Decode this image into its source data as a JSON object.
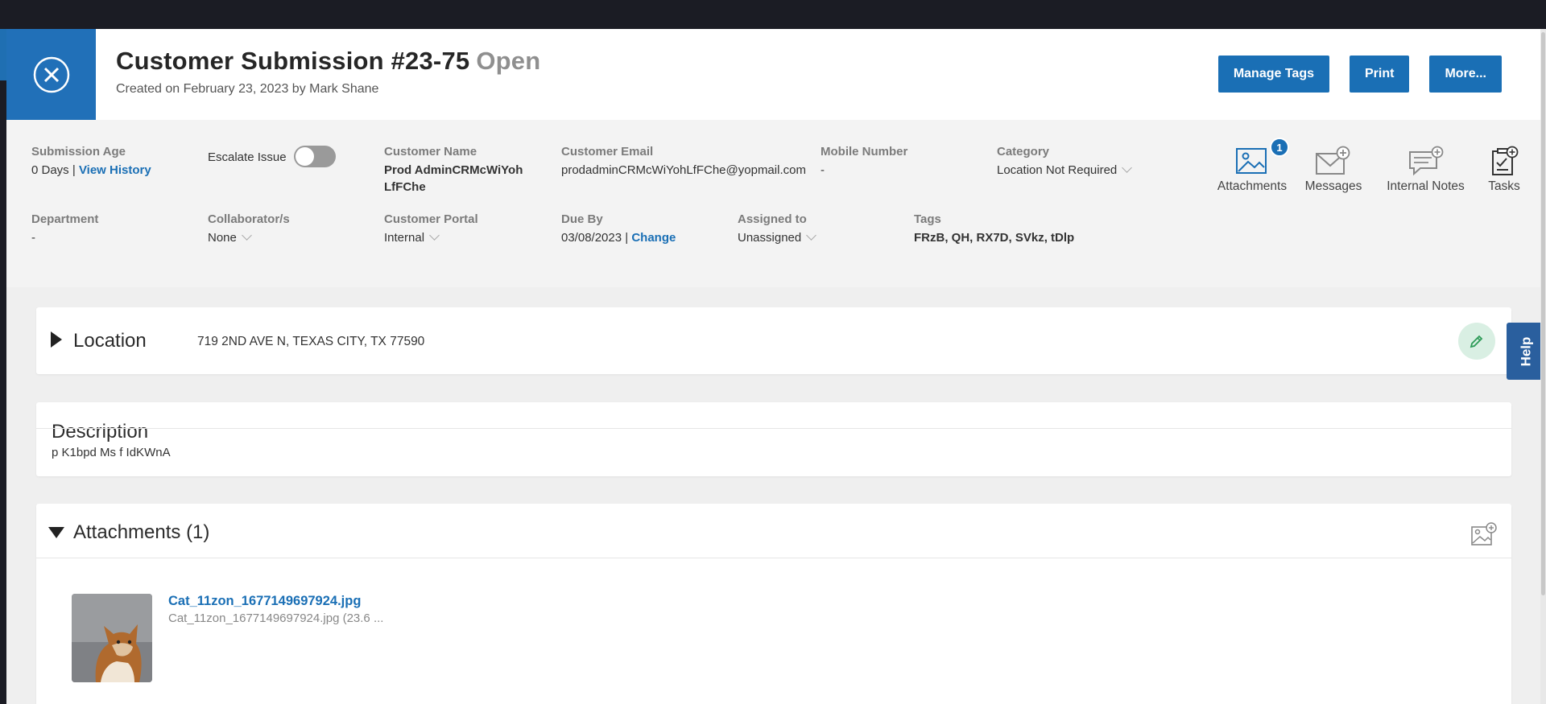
{
  "header": {
    "title": "Customer Submission #23-75",
    "status": "Open",
    "subtitle": "Created on February 23, 2023 by Mark Shane",
    "buttons": {
      "manage_tags": "Manage Tags",
      "print": "Print",
      "more": "More..."
    }
  },
  "info": {
    "submission_age": {
      "label": "Submission Age",
      "value": "0 Days",
      "separator": "|",
      "link": "View History"
    },
    "escalate": {
      "label": "Escalate Issue"
    },
    "customer_name": {
      "label": "Customer Name",
      "line1": "Prod AdminCRMcWiYoh",
      "line2": "LfFChe"
    },
    "customer_email": {
      "label": "Customer Email",
      "value": "prodadminCRMcWiYohLfFChe@yopmail.com"
    },
    "mobile": {
      "label": "Mobile Number",
      "value": "-"
    },
    "category": {
      "label": "Category",
      "value": "Location Not Required"
    },
    "department": {
      "label": "Department",
      "value": "-"
    },
    "collaborators": {
      "label": "Collaborator/s",
      "value": "None"
    },
    "portal": {
      "label": "Customer Portal",
      "value": "Internal"
    },
    "due_by": {
      "label": "Due By",
      "value": "03/08/2023",
      "separator": "|",
      "link": "Change"
    },
    "assigned": {
      "label": "Assigned to",
      "value": "Unassigned"
    },
    "tags": {
      "label": "Tags",
      "value": "FRzB, QH, RX7D, SVkz, tDlp"
    }
  },
  "tools": {
    "attachments": {
      "label": "Attachments",
      "count": "1"
    },
    "messages": {
      "label": "Messages"
    },
    "internal_notes": {
      "label": "Internal Notes"
    },
    "tasks": {
      "label": "Tasks"
    }
  },
  "location": {
    "title": "Location",
    "address": "719 2ND AVE N, TEXAS CITY, TX 77590"
  },
  "description": {
    "title": "Description",
    "text": "p K1bpd Ms f IdKWnA"
  },
  "attachments_section": {
    "title": "Attachments (1)",
    "items": [
      {
        "name": "Cat_11zon_1677149697924.jpg",
        "detail": "Cat_11zon_1677149697924.jpg (23.6 ..."
      }
    ]
  },
  "help": {
    "label": "Help"
  },
  "colors": {
    "primary": "#1a6fb5",
    "close_tile": "#2170b8",
    "edit_bg": "#d9efe3",
    "help_tab": "#2a5f9e"
  }
}
